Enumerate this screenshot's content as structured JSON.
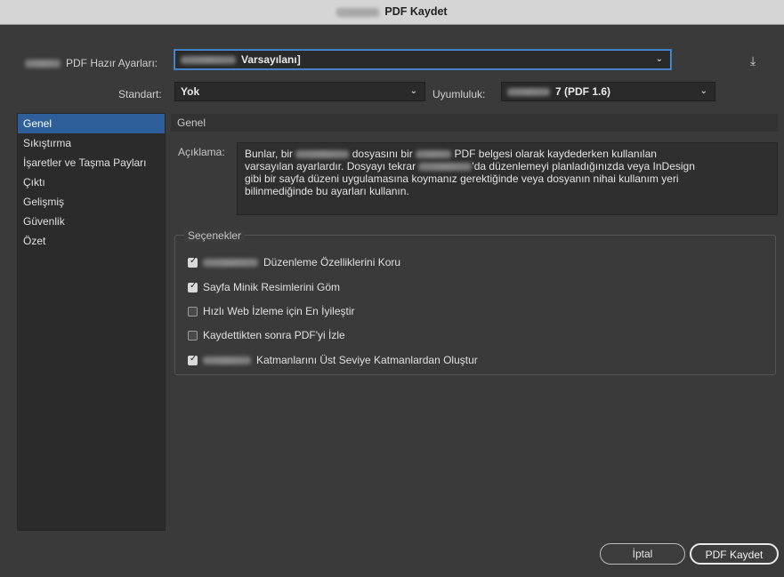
{
  "window": {
    "title": "PDF Kaydet"
  },
  "preset": {
    "label": "PDF Hazır Ayarları:",
    "value": "Varsayılanı]"
  },
  "standard": {
    "label": "Standart:",
    "value": "Yok"
  },
  "compat": {
    "label": "Uyumluluk:",
    "value": "7 (PDF 1.6)"
  },
  "sidebar": {
    "items": [
      {
        "label": "Genel",
        "active": true
      },
      {
        "label": "Sıkıştırma",
        "active": false
      },
      {
        "label": "İşaretler ve Taşma Payları",
        "active": false
      },
      {
        "label": "Çıktı",
        "active": false
      },
      {
        "label": "Gelişmiş",
        "active": false
      },
      {
        "label": "Güvenlik",
        "active": false
      },
      {
        "label": "Özet",
        "active": false
      }
    ]
  },
  "main": {
    "section_title": "Genel",
    "description_label": "Açıklama:",
    "description": {
      "l1a": "Bunlar, bir",
      "l1b": "dosyasını bir",
      "l1c": "PDF belgesi olarak kaydederken kullanılan",
      "l2a": "varsayılan ayarlardır. Dosyayı tekrar",
      "l2b": "'da düzenlemeyi planladığınızda veya InDesign",
      "l3": "gibi bir sayfa düzeni uygulamasına koymanız gerektiğinde veya dosyanın nihai kullanım yeri",
      "l4": "bilinmediğinde bu ayarları kullanın."
    },
    "options_title": "Seçenekler",
    "options": [
      {
        "label": "Düzenleme Özelliklerini Koru",
        "checked": true
      },
      {
        "label": "Sayfa Minik Resimlerini Göm",
        "checked": true
      },
      {
        "label": "Hızlı Web İzleme için En İyileştir",
        "checked": false
      },
      {
        "label": "Kaydettikten sonra PDF'yi İzle",
        "checked": false
      },
      {
        "label": "Katmanlarını Üst Seviye Katmanlardan Oluştur",
        "checked": true
      }
    ]
  },
  "buttons": {
    "cancel": "İptal",
    "save": "PDF Kaydet"
  }
}
